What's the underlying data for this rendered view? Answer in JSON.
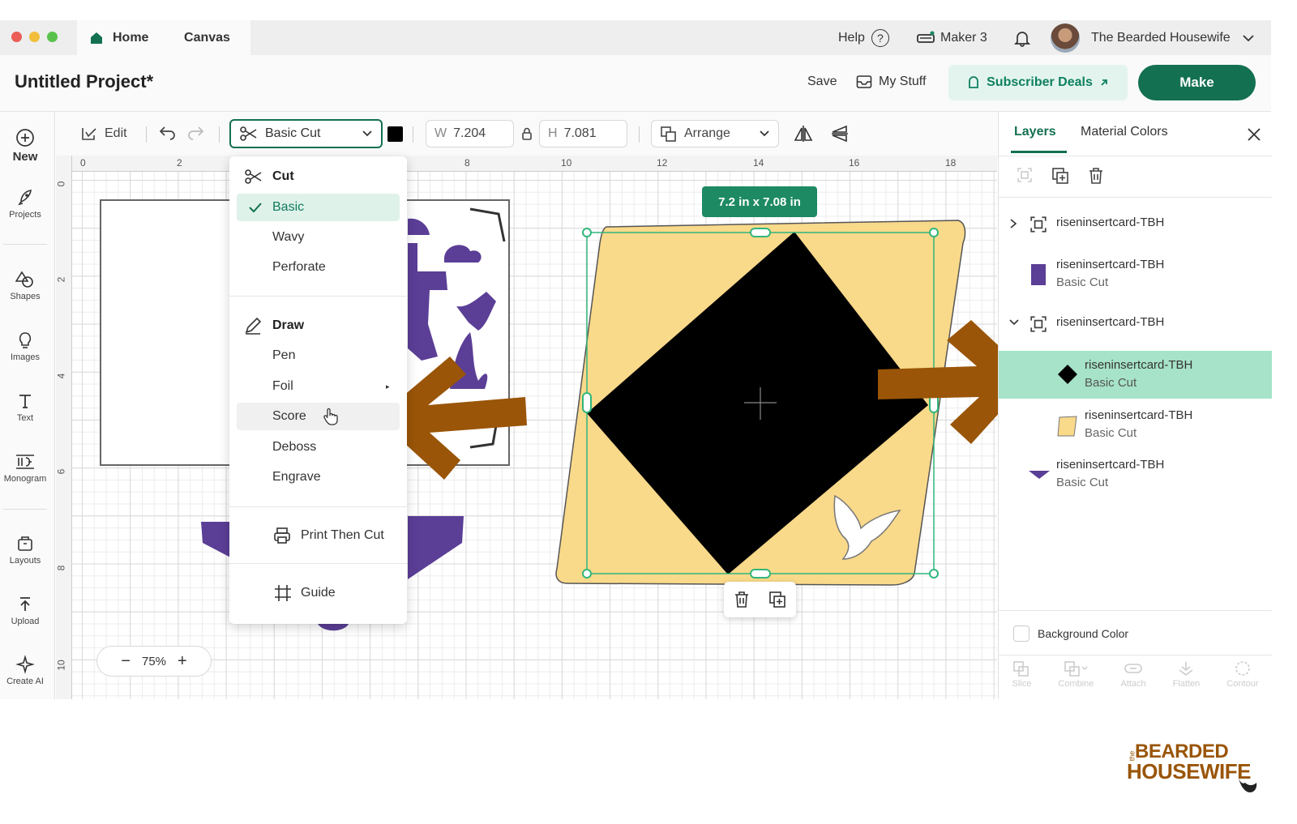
{
  "tabs": {
    "home": "Home",
    "canvas": "Canvas"
  },
  "titlebar": {
    "help": "Help",
    "machine": "Maker 3",
    "user": "The Bearded Housewife"
  },
  "header": {
    "project_title": "Untitled Project*",
    "save": "Save",
    "my_stuff": "My Stuff",
    "subscriber_deals": "Subscriber Deals",
    "make": "Make"
  },
  "sidebar": {
    "new": "New",
    "projects": "Projects",
    "shapes": "Shapes",
    "images": "Images",
    "text": "Text",
    "monogram": "Monogram",
    "layouts": "Layouts",
    "upload": "Upload",
    "create_ai": "Create AI"
  },
  "toolbar": {
    "edit": "Edit",
    "operation": "Basic Cut",
    "width_label": "W",
    "width_value": "7.204",
    "height_label": "H",
    "height_value": "7.081",
    "arrange": "Arrange"
  },
  "ruler": {
    "h_ticks": [
      "0",
      "2",
      "8",
      "10",
      "12",
      "14",
      "16",
      "18"
    ],
    "v_ticks": [
      "0",
      "2",
      "4",
      "6",
      "8",
      "10"
    ]
  },
  "menu": {
    "cut_heading": "Cut",
    "basic": "Basic",
    "wavy": "Wavy",
    "perforate": "Perforate",
    "draw_heading": "Draw",
    "pen": "Pen",
    "foil": "Foil",
    "score": "Score",
    "deboss": "Deboss",
    "engrave": "Engrave",
    "print_then_cut": "Print Then Cut",
    "guide": "Guide"
  },
  "canvas": {
    "size_label": "7.2  in x 7.08  in",
    "zoom": "75%"
  },
  "panel": {
    "tab_layers": "Layers",
    "tab_material_colors": "Material Colors",
    "layers": [
      {
        "name": "riseninsertcard-TBH",
        "sub": ""
      },
      {
        "name": "riseninsertcard-TBH",
        "sub": "Basic Cut"
      },
      {
        "name": "riseninsertcard-TBH",
        "sub": ""
      },
      {
        "name": "riseninsertcard-TBH",
        "sub": "Basic Cut"
      },
      {
        "name": "riseninsertcard-TBH",
        "sub": "Basic Cut"
      },
      {
        "name": "riseninsertcard-TBH",
        "sub": "Basic Cut"
      }
    ],
    "background_color": "Background Color",
    "bottom_tools": [
      "Slice",
      "Combine",
      "Attach",
      "Flatten",
      "Contour"
    ]
  },
  "brand": {
    "small": "the",
    "line1": "BEARDED",
    "line2": "HOUSEWIFE"
  },
  "colors": {
    "accent": "#137050",
    "purple": "#5b3e96",
    "yellow": "#f9d98a",
    "arrow": "#9a5508"
  }
}
